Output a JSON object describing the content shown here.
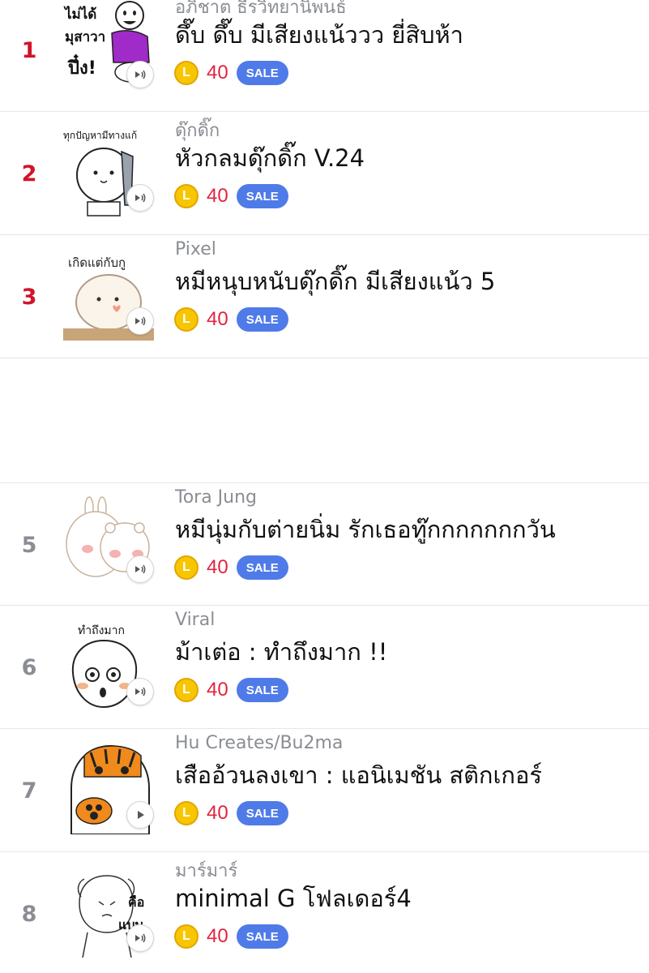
{
  "items": [
    {
      "rank": "1",
      "author": "อภิชาต ธีรวิทยานิพนธ์",
      "title": "ดึ๊บ ดึ๊บ มีเสียงแน้ววว ยี่สิบห้า",
      "price": "40",
      "coin_letter": "L",
      "sale": "SALE",
      "thumb_text": "ไม่ได้ มุสาวา ปึ๋ง!",
      "icon": "speaker-icon"
    },
    {
      "rank": "2",
      "author": "ดุ๊กดิ๊ก",
      "title": "หัวกลมดุ๊กดิ๊ก V.24",
      "price": "40",
      "coin_letter": "L",
      "sale": "SALE",
      "thumb_text": "ทุกปัญหามีทางแก้",
      "icon": "speaker-icon"
    },
    {
      "rank": "3",
      "author": "Pixel",
      "title": "หมีหนุบหนับดุ๊กดิ๊ก มีเสียงแน้ว 5",
      "price": "40",
      "coin_letter": "L",
      "sale": "SALE",
      "thumb_text": "เกิดแต่กับกู",
      "icon": "speaker-icon"
    },
    {
      "rank": "5",
      "author": "Tora Jung",
      "title": "หมีนุ่มกับต่ายนิ่ม รักเธอทู๊กกกกกกกวัน",
      "price": "40",
      "coin_letter": "L",
      "sale": "SALE",
      "thumb_text": "",
      "icon": "speaker-icon"
    },
    {
      "rank": "6",
      "author": "Viral",
      "title": "ม้าเต่อ : ทำถึงมาก !!",
      "price": "40",
      "coin_letter": "L",
      "sale": "SALE",
      "thumb_text": "ทำถึงมาก",
      "icon": "speaker-icon"
    },
    {
      "rank": "7",
      "author": "Hu Creates/Bu2ma",
      "title": "เสืออ้วนลงเขา : แอนิเมชัน สติกเกอร์",
      "price": "40",
      "coin_letter": "L",
      "sale": "SALE",
      "thumb_text": "",
      "icon": "play-icon"
    },
    {
      "rank": "8",
      "author": "มาร์มาร์",
      "title": "minimal G โฟลเดอร์4",
      "price": "40",
      "coin_letter": "L",
      "sale": "SALE",
      "thumb_text": "คือ แบบ",
      "icon": "speaker-icon"
    }
  ]
}
